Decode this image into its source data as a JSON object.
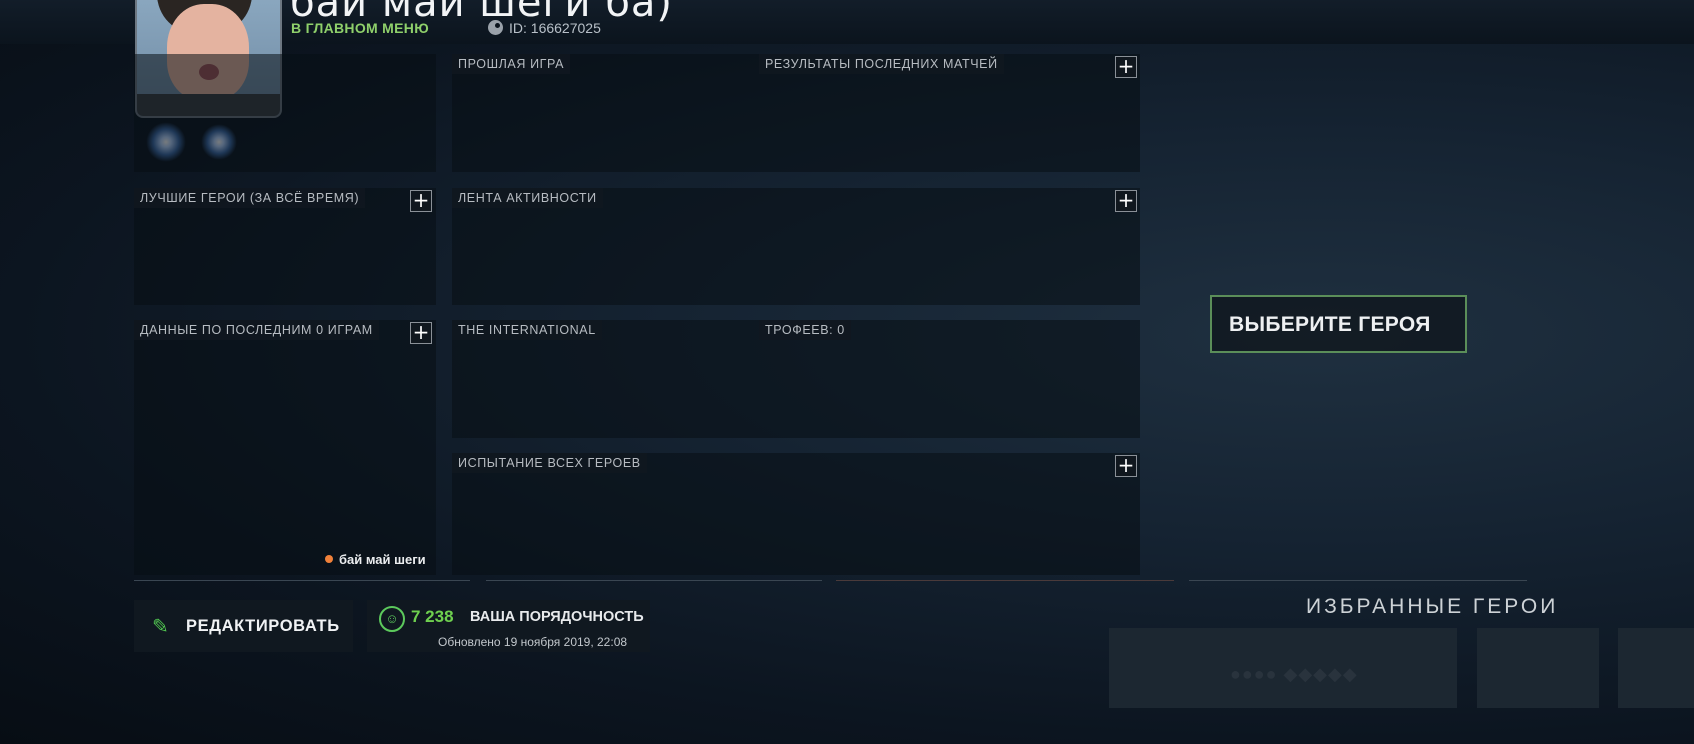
{
  "profile": {
    "name": "бай май шеги ба)",
    "main_menu_link": "В ГЛАВНОМ МЕНЮ",
    "id_label": "ID: 166627025"
  },
  "panels": {
    "last_game": "ПРОШЛАЯ ИГРА",
    "recent_results": "РЕЗУЛЬТАТЫ ПОСЛЕДНИХ МАТЧЕЙ",
    "best_heroes": "ЛУЧШИЕ ГЕРОИ (ЗА ВСЁ ВРЕМЯ)",
    "activity_feed": "ЛЕНТА АКТИВНОСТИ",
    "last_games_stats": "ДАННЫЕ ПО ПОСЛЕДНИМ 0 ИГРАМ",
    "the_international": "THE INTERNATIONAL",
    "trophies": "ТРОФЕЕВ: 0",
    "all_heroes_challenge": "ИСПЫТАНИЕ ВСЕХ ГЕРОЕВ",
    "plus_symbol": "+"
  },
  "status": {
    "name": "бай май шеги",
    "dot_color": "#f0813a"
  },
  "bottom": {
    "edit_label": "РЕДАКТИРОВАТЬ",
    "conduct_value": "7 238",
    "conduct_label": "ВАША ПОРЯДОЧНОСТЬ",
    "conduct_updated": "Обновлено 19 ноября 2019, 22:08"
  },
  "hero": {
    "pick_label": "ВЫБЕРИТЕ ГЕРОЯ",
    "favorites_title": "ИЗБРАННЫЕ ГЕРОИ"
  },
  "icons": {
    "edit": "pencil-icon",
    "conduct": "smile-icon",
    "steam": "steam-icon"
  },
  "colors": {
    "accent_green": "#6fd04f",
    "menu_green": "#8fd06b",
    "button_border": "#5b8e59"
  }
}
